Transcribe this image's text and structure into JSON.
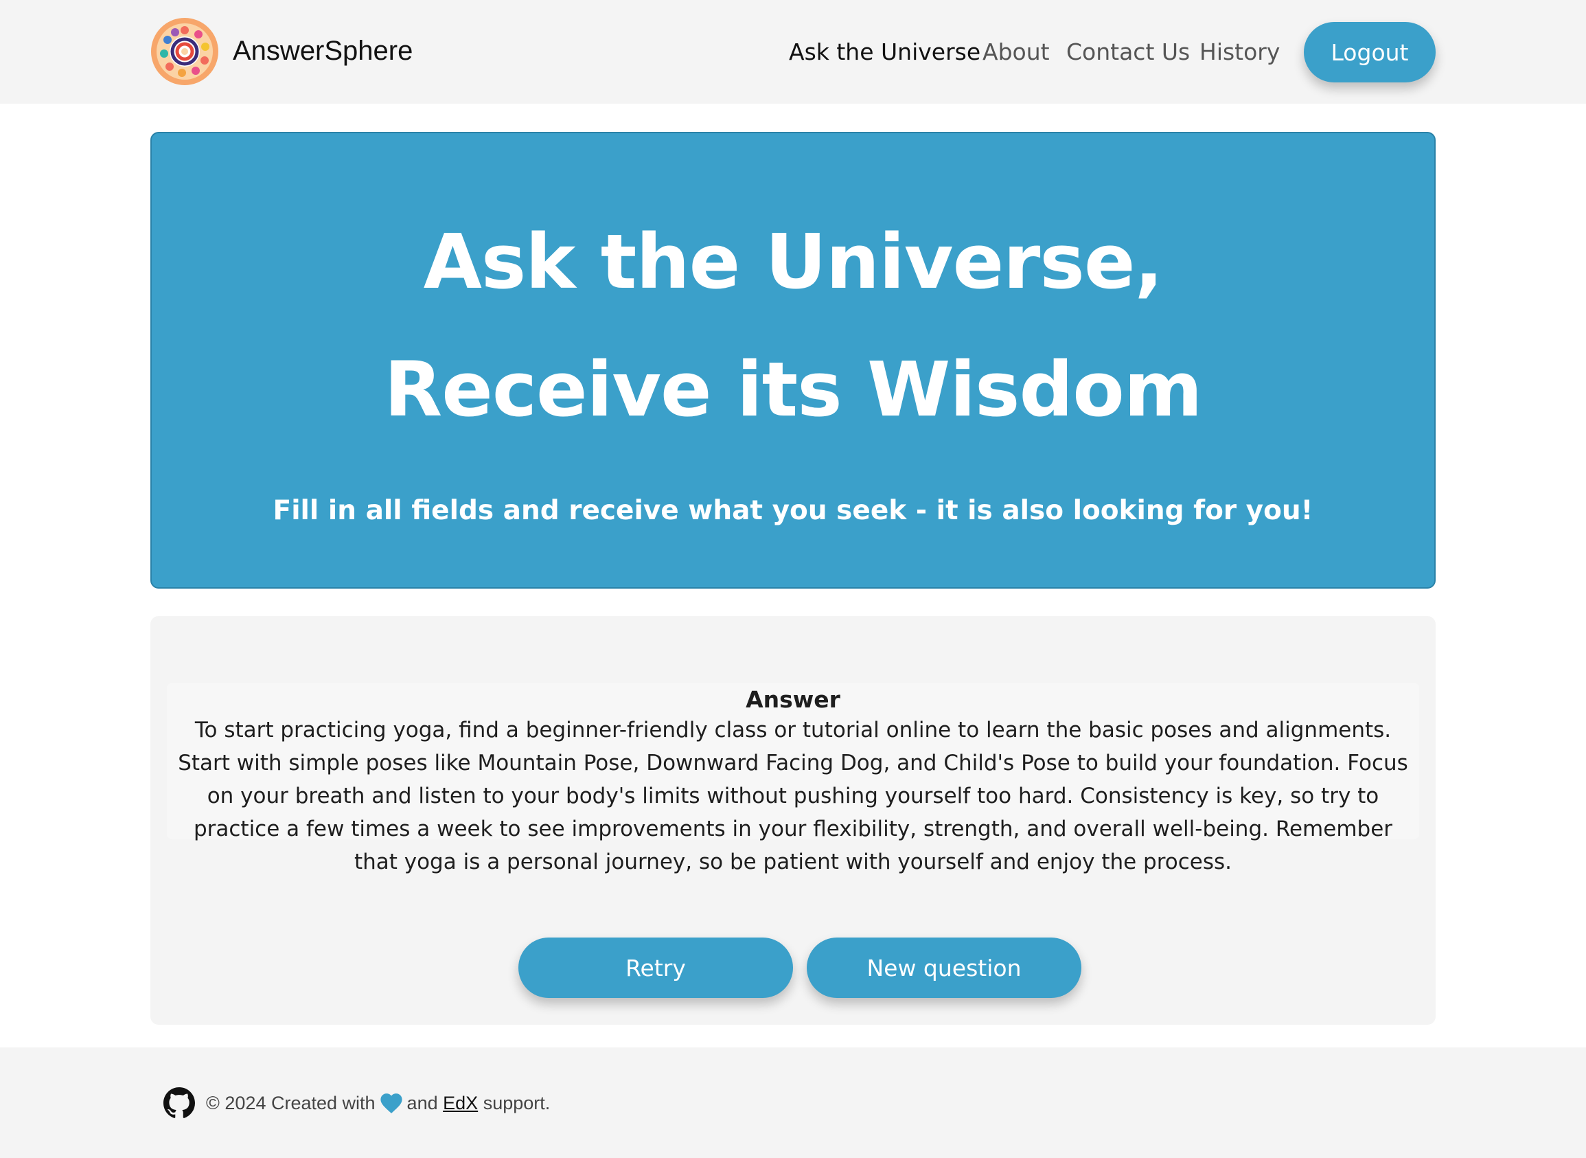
{
  "header": {
    "brand": "AnswerSphere",
    "logo_icon": "mandala-logo-icon",
    "nav": [
      {
        "label": "Ask the Universe",
        "active": true
      },
      {
        "label": "About",
        "active": false
      },
      {
        "label": "Contact Us",
        "active": false
      },
      {
        "label": "History",
        "active": false
      }
    ],
    "logout_label": "Logout"
  },
  "hero": {
    "title_line1": "Ask the Universe,",
    "title_line2": "Receive its Wisdom",
    "subtitle": "Fill in all fields and receive what you seek - it is also looking for you!"
  },
  "answer": {
    "heading": "Answer",
    "text": "To start practicing yoga, find a beginner-friendly class or tutorial online to learn the basic poses and alignments. Start with simple poses like Mountain Pose, Downward Facing Dog, and Child's Pose to build your foundation. Focus on your breath and listen to your body's limits without pushing yourself too hard. Consistency is key, so try to practice a few times a week to see improvements in your flexibility, strength, and overall well-being. Remember that yoga is a personal journey, so be patient with yourself and enjoy the process.",
    "retry_label": "Retry",
    "new_question_label": "New question"
  },
  "footer": {
    "github_icon": "github-icon",
    "text_before": "© 2024 Created with",
    "heart_icon": "heart-icon",
    "text_and": "and",
    "link_label": "EdX",
    "text_after": "support."
  },
  "colors": {
    "accent": "#3ba0ca",
    "header_bg": "#f4f4f4",
    "card_bg": "#f4f4f4",
    "text": "#1e1e1e"
  }
}
